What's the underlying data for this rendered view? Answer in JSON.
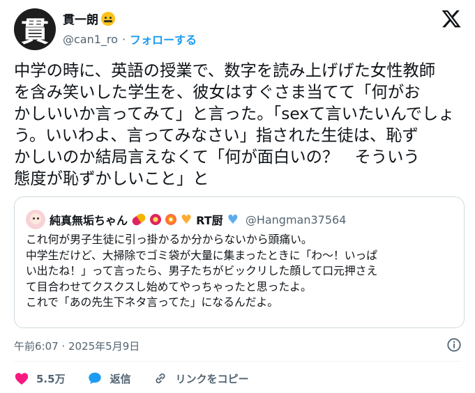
{
  "author": {
    "display_name": "貫一朗",
    "handle": "@can1_ro",
    "separator": "·",
    "follow_label": "フォローする",
    "avatar_char": "貫"
  },
  "tweet": {
    "lines": [
      "中学の時に、英語の授業で、数字を読み上げげた女性教師",
      "を含み笑いした学生を、彼女はすぐさま当てて「何がお",
      "かしいいか言ってみて」と言った。「sexて言いたいんでしょ",
      "う。いいわよ、言ってみなさい」指された生徒は、恥ず",
      "かしいのか結局言えなくて「何が面白いの？　そういう",
      "態度が恥ずかしいこと」と"
    ]
  },
  "quote": {
    "display_name": "純真無垢ちゃん",
    "name_suffix": "RT厨",
    "handle": "@Hangman37564",
    "lines": [
      "これ何が男子生徒に引っ掛かるか分からないから頭痛い。",
      "中学生だけど、大掃除でゴミ袋が大量に集まったときに「わ〜！いっぱ",
      "い出たね！」って言ったら、男子たちがビックリした顔して口元押さえ",
      "て目合わせてクスクスし始めてやっちゃったと思ったよ。",
      "これで「あの先生下ネタ言ってた」になるんだよ。"
    ]
  },
  "timestamp": "午前6:07 · 2025年5月9日",
  "actions": {
    "like_count": "5.5万",
    "reply_label": "返信",
    "copy_link_label": "リンクをコピー"
  },
  "colors": {
    "accent": "#1d9bf0",
    "like": "#f91880",
    "text": "#0f1419",
    "secondary": "#536471"
  }
}
